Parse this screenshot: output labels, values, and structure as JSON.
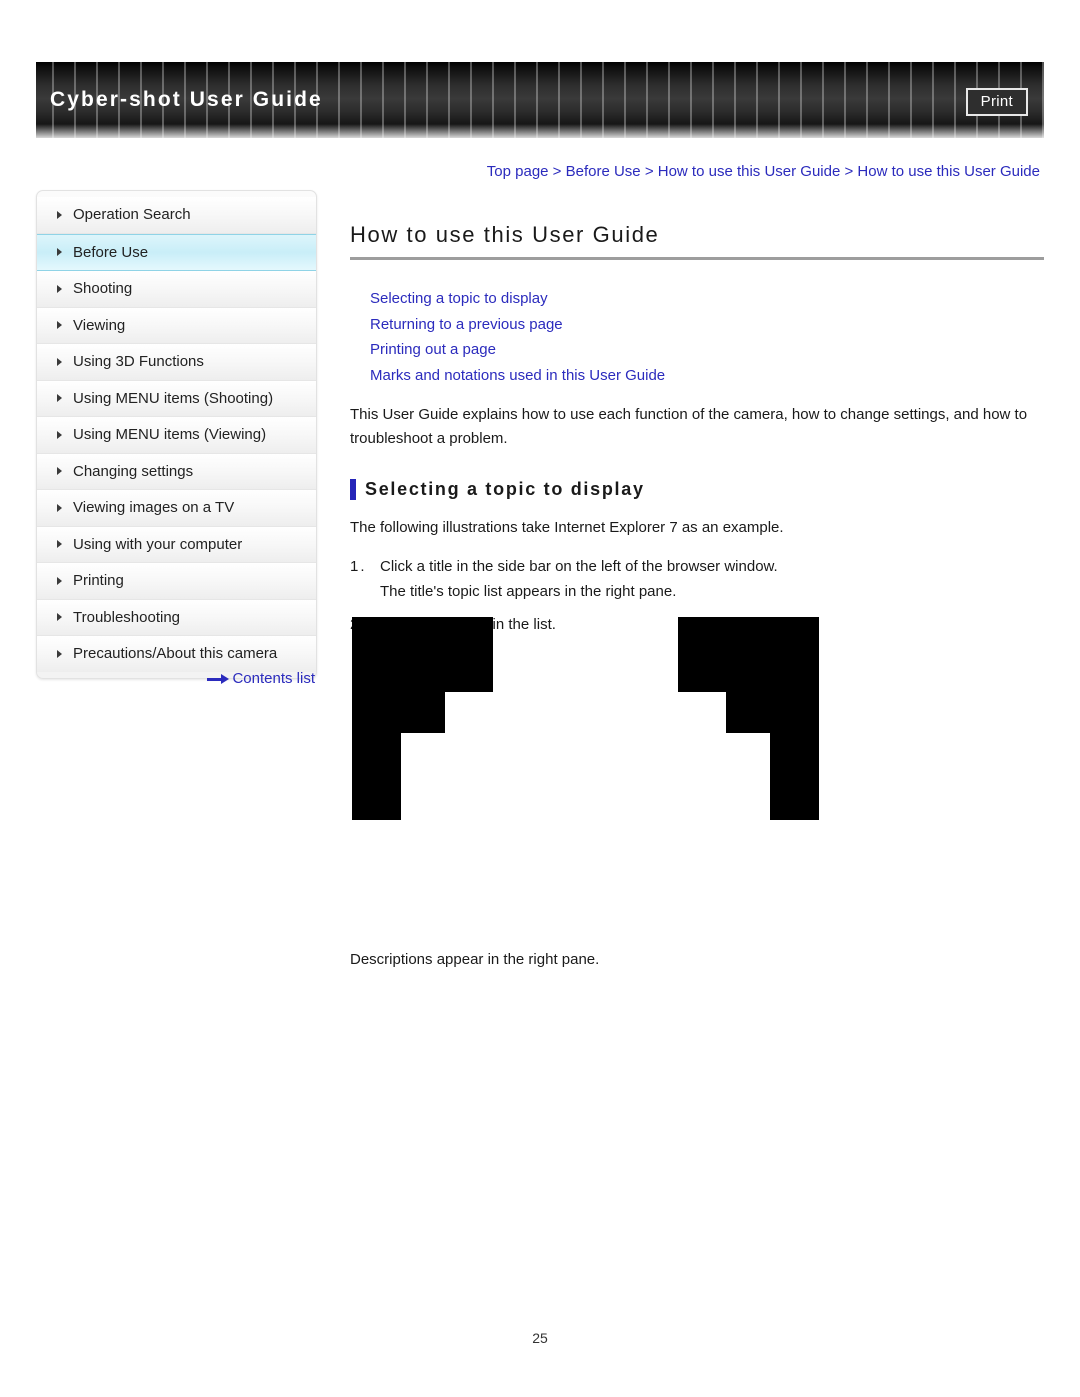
{
  "header": {
    "title": "Cyber-shot User Guide",
    "print_label": "Print"
  },
  "breadcrumb": {
    "text": "Top page > Before Use > How to use this User Guide > How to use this User Guide"
  },
  "sidebar": {
    "items": [
      {
        "label": "Operation Search",
        "selected": false
      },
      {
        "label": "Before Use",
        "selected": true
      },
      {
        "label": "Shooting",
        "selected": false
      },
      {
        "label": "Viewing",
        "selected": false
      },
      {
        "label": "Using 3D Functions",
        "selected": false
      },
      {
        "label": "Using MENU items (Shooting)",
        "selected": false
      },
      {
        "label": "Using MENU items (Viewing)",
        "selected": false
      },
      {
        "label": "Changing settings",
        "selected": false
      },
      {
        "label": "Viewing images on a TV",
        "selected": false
      },
      {
        "label": "Using with your computer",
        "selected": false
      },
      {
        "label": "Printing",
        "selected": false
      },
      {
        "label": "Troubleshooting",
        "selected": false
      },
      {
        "label": "Precautions/About this camera",
        "selected": false
      }
    ],
    "contents_link": "Contents list"
  },
  "main": {
    "page_title": "How to use this User Guide",
    "topic_links": [
      "Selecting a topic to display",
      "Returning to a previous page",
      "Printing out a page",
      "Marks and notations used in this User Guide"
    ],
    "intro": "This User Guide explains how to use each function of the camera, how to change settings, and how to troubleshoot a problem.",
    "section_title": "Selecting a topic to display",
    "lead": "The following illustrations take Internet Explorer 7 as an example.",
    "steps": [
      {
        "number": "1.",
        "text": "Click a title in the side bar on the left of the browser window.",
        "sub": "The title's topic list appears in the right pane."
      },
      {
        "number": "2.",
        "text": "Click a topic title in the list.",
        "sub": ""
      }
    ],
    "closing": "Descriptions appear in the right pane."
  },
  "footer": {
    "page_number": "25"
  },
  "colors": {
    "link": "#2b2bbd",
    "accent_bar": "#2424b8",
    "selected_row": "#c9eef8",
    "rule": "#9d9d9d"
  }
}
